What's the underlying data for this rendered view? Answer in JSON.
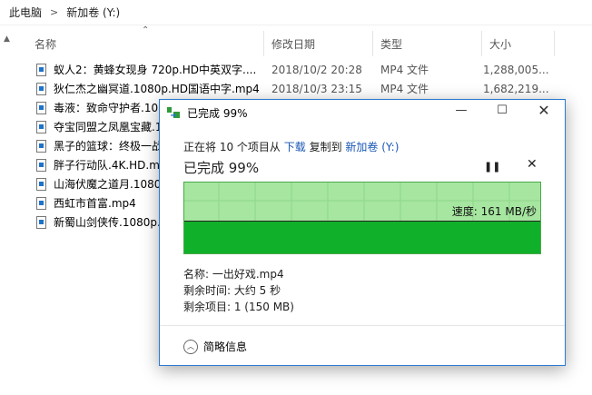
{
  "breadcrumb": {
    "root": "此电脑",
    "current": "新加卷 (Y:)",
    "separator": ">"
  },
  "columns": {
    "name": "名称",
    "date": "修改日期",
    "type": "类型",
    "size": "大小"
  },
  "files": [
    {
      "name": "蚁人2：黄蜂女现身 720p.HD中英双字....",
      "date": "2018/10/2 20:28",
      "type": "MP4 文件",
      "size": "1,288,005..."
    },
    {
      "name": "狄仁杰之幽冥道.1080p.HD国语中字.mp4",
      "date": "2018/10/3 23:15",
      "type": "MP4 文件",
      "size": "1,682,219..."
    },
    {
      "name": "毒液：致命守护者.108",
      "date": "",
      "type": "",
      "size": ""
    },
    {
      "name": "夺宝同盟之凤凰宝藏.1",
      "date": "",
      "type": "",
      "size": ""
    },
    {
      "name": "黑子的篮球：终极一战",
      "date": "",
      "type": "",
      "size": ""
    },
    {
      "name": "胖子行动队.4K.HD.mp",
      "date": "",
      "type": "",
      "size": ""
    },
    {
      "name": "山海伏魔之道月.1080",
      "date": "",
      "type": "",
      "size": ""
    },
    {
      "name": "西虹市首富.mp4",
      "date": "",
      "type": "",
      "size": ""
    },
    {
      "name": "新蜀山剑侠传.1080p.",
      "date": "",
      "type": "",
      "size": ""
    }
  ],
  "dialog": {
    "title": "已完成 99%",
    "status_prefix": "正在将 10 个项目从",
    "source": "下载",
    "status_mid": "复制到",
    "destination": "新加卷 (Y:)",
    "progress_title": "已完成 99%",
    "progress_fraction": 0.99,
    "speed_label": "速度: 161 MB/秒",
    "name_line": "名称: 一出好戏.mp4",
    "time_line": "剩余时间: 大约 5 秒",
    "items_line": "剩余项目: 1 (150 MB)",
    "less_info": "简略信息",
    "pause_icon": "pause-icon",
    "cancel_icon": "close-icon"
  }
}
